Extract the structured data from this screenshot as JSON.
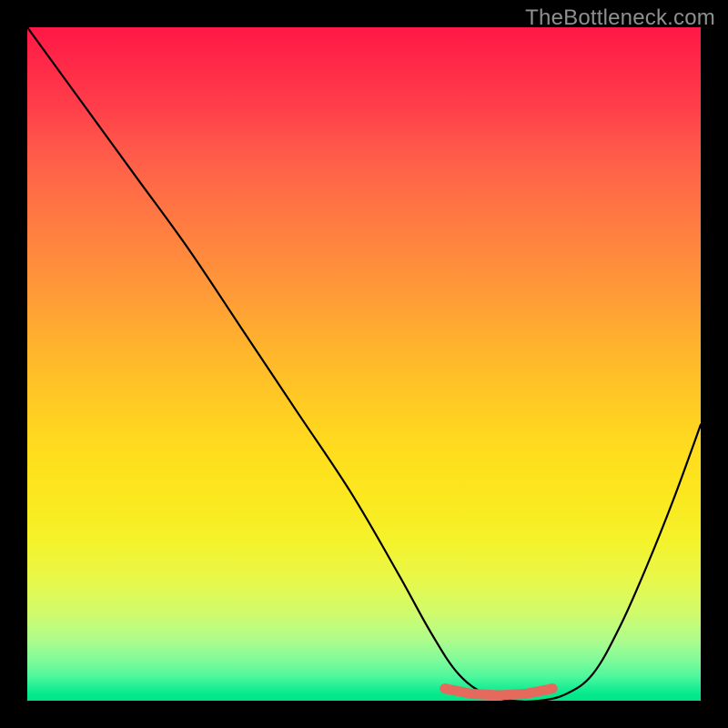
{
  "watermark": "TheBottleneck.com",
  "chart_data": {
    "type": "line",
    "title": "",
    "xlabel": "",
    "ylabel": "",
    "xlim": [
      0,
      100
    ],
    "ylim": [
      0,
      100
    ],
    "grid": false,
    "series": [
      {
        "name": "bottleneck-curve",
        "x": [
          0,
          8,
          16,
          24,
          32,
          40,
          48,
          55,
          60,
          64,
          68,
          72,
          76,
          80,
          84,
          88,
          92,
          96,
          100
        ],
        "values": [
          100,
          89,
          78,
          67,
          55,
          43,
          31,
          19,
          10,
          4,
          1,
          0,
          0,
          1,
          4,
          11,
          20,
          30,
          41
        ]
      },
      {
        "name": "sweet-spot-marker",
        "x": [
          62,
          66,
          70,
          74,
          78
        ],
        "values": [
          1,
          0.2,
          0,
          0.2,
          1
        ]
      }
    ],
    "gradient_stops": [
      {
        "pos": 0,
        "color": "#ff1845"
      },
      {
        "pos": 25,
        "color": "#ff6f45"
      },
      {
        "pos": 50,
        "color": "#ffc024"
      },
      {
        "pos": 75,
        "color": "#f3f228"
      },
      {
        "pos": 90,
        "color": "#b0fc88"
      },
      {
        "pos": 100,
        "color": "#00e686"
      }
    ],
    "annotations": [],
    "legend": {
      "visible": false
    }
  }
}
